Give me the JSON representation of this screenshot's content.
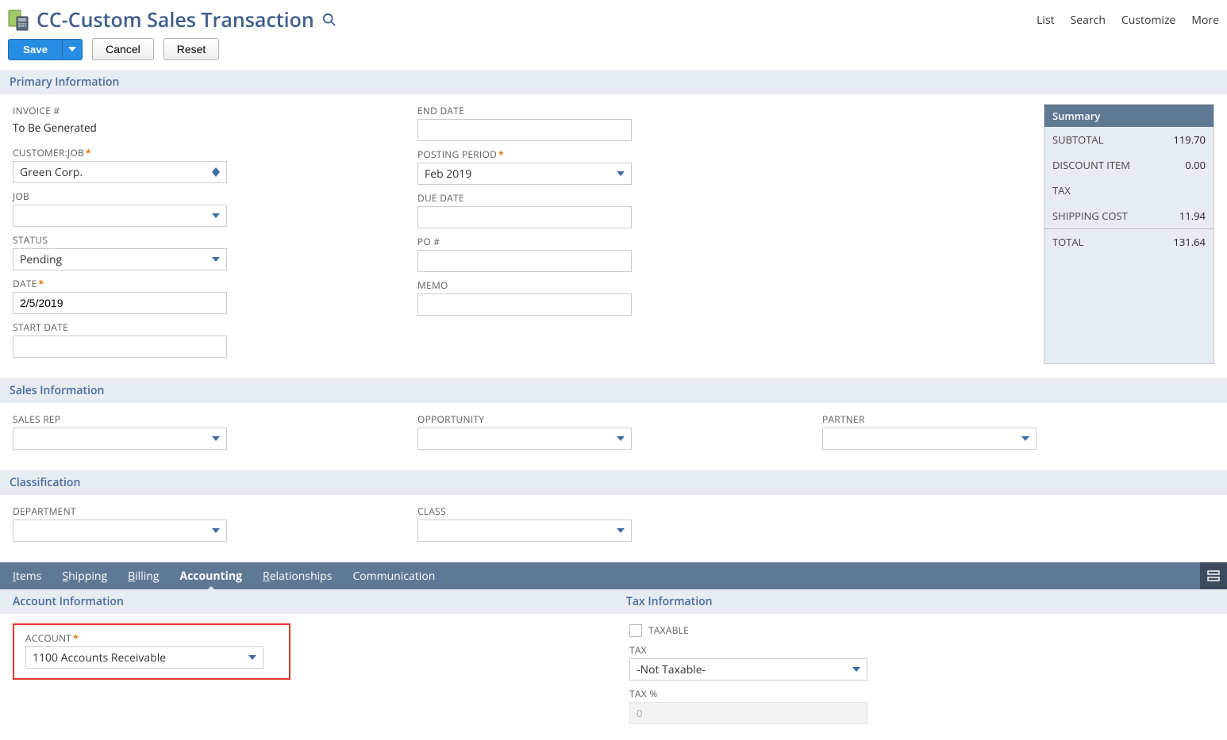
{
  "header": {
    "title": "CC-Custom Sales Transaction",
    "nav": {
      "list": "List",
      "search": "Search",
      "customize": "Customize",
      "more": "More"
    }
  },
  "actions": {
    "save": "Save",
    "cancel": "Cancel",
    "reset": "Reset"
  },
  "sections": {
    "primary": "Primary Information",
    "sales": "Sales Information",
    "classification": "Classification",
    "account_info": "Account Information",
    "tax_info": "Tax Information"
  },
  "primary": {
    "invoice_label": "INVOICE #",
    "invoice_value": "To Be Generated",
    "customer_label": "CUSTOMER:JOB",
    "customer_value": "Green Corp.",
    "job_label": "JOB",
    "job_value": "",
    "status_label": "STATUS",
    "status_value": "Pending",
    "date_label": "DATE",
    "date_value": "2/5/2019",
    "start_date_label": "START DATE",
    "start_date_value": "",
    "end_date_label": "END DATE",
    "end_date_value": "",
    "posting_label": "POSTING PERIOD",
    "posting_value": "Feb 2019",
    "due_date_label": "DUE DATE",
    "due_date_value": "",
    "po_label": "PO #",
    "po_value": "",
    "memo_label": "MEMO",
    "memo_value": ""
  },
  "summary": {
    "title": "Summary",
    "subtotal_label": "SUBTOTAL",
    "subtotal_value": "119.70",
    "discount_label": "DISCOUNT ITEM",
    "discount_value": "0.00",
    "tax_label": "TAX",
    "tax_value": "",
    "shipping_label": "SHIPPING COST",
    "shipping_value": "11.94",
    "total_label": "TOTAL",
    "total_value": "131.64"
  },
  "sales": {
    "rep_label": "SALES REP",
    "rep_value": "",
    "opp_label": "OPPORTUNITY",
    "opp_value": "",
    "partner_label": "PARTNER",
    "partner_value": ""
  },
  "classification": {
    "dept_label": "DEPARTMENT",
    "dept_value": "",
    "class_label": "CLASS",
    "class_value": ""
  },
  "tabs": {
    "items": "Items",
    "shipping": "Shipping",
    "billing": "Billing",
    "accounting": "Accounting",
    "relationships": "Relationships",
    "communication": "Communication"
  },
  "accounting": {
    "account_label": "ACCOUNT",
    "account_value": "1100 Accounts Receivable",
    "taxable_label": "TAXABLE",
    "tax_label": "TAX",
    "tax_value": "-Not Taxable-",
    "tax_pct_label": "TAX %",
    "tax_pct_value": "0"
  }
}
